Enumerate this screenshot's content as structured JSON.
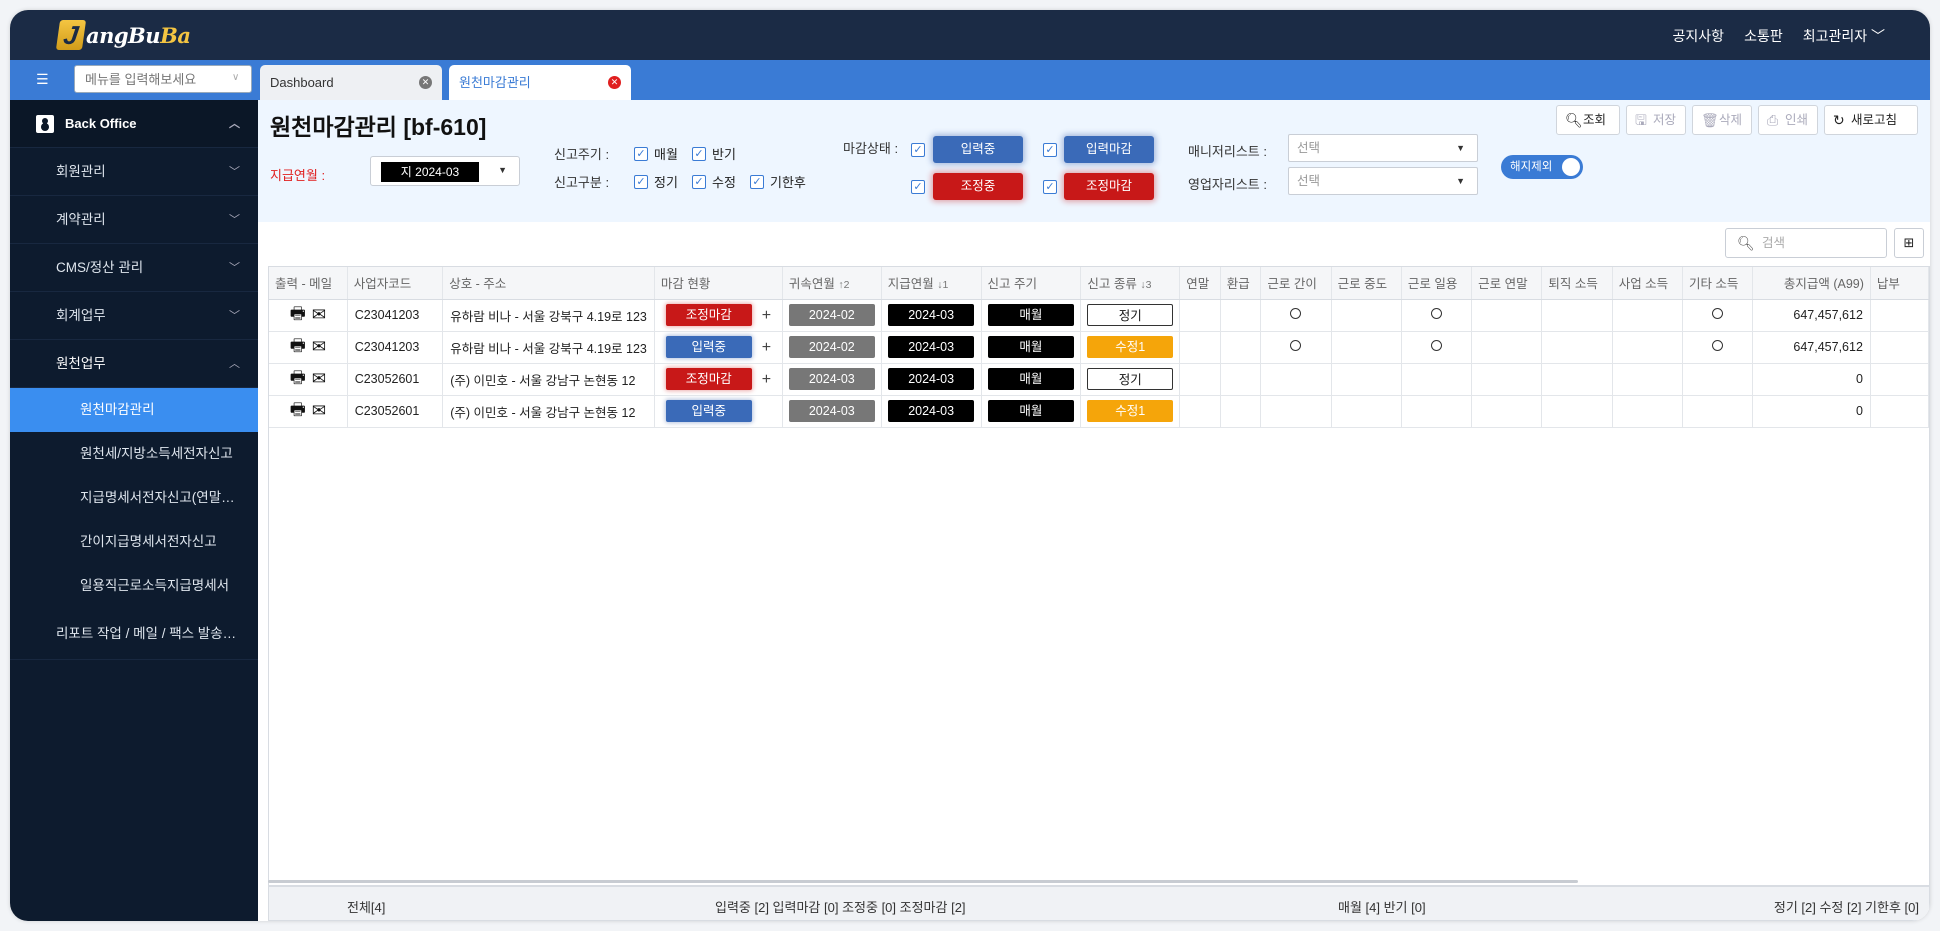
{
  "app": {
    "logo_text_a": "angBu",
    "logo_text_b": "Ba",
    "logo_letter": "J",
    "top_nav": [
      "공지사항",
      "소통판",
      "최고관리자"
    ]
  },
  "tabbar": {
    "menu_search_placeholder": "메뉴를 입력해보세요",
    "tabs": [
      "Dashboard",
      "원천마감관리"
    ]
  },
  "sidebar": {
    "header": "Back Office",
    "items": [
      "회원관리",
      "계약관리",
      "CMS/정산 관리",
      "회계업무",
      "원천업무"
    ],
    "sub_items": [
      "원천마감관리",
      "원천세/지방소득세전자신고",
      "지급명세서전자신고(연말정산)",
      "간이지급명세서전자신고",
      "일용직근로소득지급명세서"
    ],
    "report": "리포트 작업 / 메일 / 팩스 발송관리"
  },
  "header": {
    "title": "원천마감관리 [bf-610]",
    "buttons": {
      "search": "조회",
      "save": "저장",
      "delete": "삭제",
      "print": "인쇄",
      "refresh": "새로고침"
    }
  },
  "filters": {
    "paymonth_label": "지급연월 :",
    "paymonth_value": "지 2024-03",
    "report_cycle_label": "신고주기 :",
    "report_cycle_opts": [
      "매월",
      "반기"
    ],
    "report_kind_label": "신고구분 :",
    "report_kind_opts": [
      "정기",
      "수정",
      "기한후"
    ],
    "close_status_label": "마감상태 :",
    "close_status_opts": [
      "입력중",
      "입력마감",
      "조정중",
      "조정마감"
    ],
    "manager_label": "매니저리스트 :",
    "sales_label": "영업자리스트 :",
    "select_placeholder": "선택",
    "toggle_label": "해지제외"
  },
  "grid": {
    "search_placeholder": "검색",
    "columns": [
      "출력 - 메일",
      "사업자코드",
      "상호 - 주소",
      "마감 현황",
      "귀속연월",
      "지급연월",
      "신고 주기",
      "신고 종류",
      "연말",
      "환급",
      "근로 간이",
      "근로 중도",
      "근로 일용",
      "근로 연말",
      "퇴직 소득",
      "사업 소득",
      "기타 소득",
      "총지급액 (A99)",
      "납부"
    ],
    "sort_marks": {
      "col4": "↑2",
      "col5": "↓1",
      "col7": "↓3"
    },
    "rows": [
      {
        "code": "C23041203",
        "name": "유하람 비나 - 서울 강북구 4.19로 123",
        "status": "조정마감",
        "status_color": "red",
        "attr": "2024-02",
        "pay": "2024-03",
        "cycle": "매월",
        "kind": "정기",
        "kind_style": "outline",
        "simple": "O",
        "daily": "O",
        "etc": "O",
        "total": "647,457,612"
      },
      {
        "code": "C23041203",
        "name": "유하람 비나 - 서울 강북구 4.19로 123",
        "status": "입력중",
        "status_color": "blue",
        "attr": "2024-02",
        "pay": "2024-03",
        "cycle": "매월",
        "kind": "수정1",
        "kind_style": "orange",
        "simple": "O",
        "daily": "O",
        "etc": "O",
        "total": "647,457,612"
      },
      {
        "code": "C23052601",
        "name": "(주) 이민호 - 서울 강남구 논현동 12",
        "status": "조정마감",
        "status_color": "red",
        "attr": "2024-03",
        "pay": "2024-03",
        "cycle": "매월",
        "kind": "정기",
        "kind_style": "outline",
        "simple": "",
        "daily": "",
        "etc": "",
        "total": "0"
      },
      {
        "code": "C23052601",
        "name": "(주) 이민호 - 서울 강남구 논현동 12",
        "status": "입력중",
        "status_color": "blue",
        "attr": "2024-03",
        "pay": "2024-03",
        "cycle": "매월",
        "kind": "수정1",
        "kind_style": "orange",
        "simple": "",
        "daily": "",
        "etc": "",
        "total": "0"
      }
    ]
  },
  "footer": {
    "total": "전체[4]",
    "status": "입력중 [2] 입력마감 [0] 조정중 [0] 조정마감 [2]",
    "cycle": "매월 [4] 반기 [0]",
    "kind": "정기 [2] 수정 [2] 기한후 [0]"
  },
  "colors": {
    "topbar": "#1b2b45",
    "tabbar": "#3a7bd5",
    "sidebar": "#0d1b2e",
    "active": "#3a8ef0",
    "red": "#c81818",
    "blue": "#3a6ab8",
    "orange": "#f5a50a"
  }
}
